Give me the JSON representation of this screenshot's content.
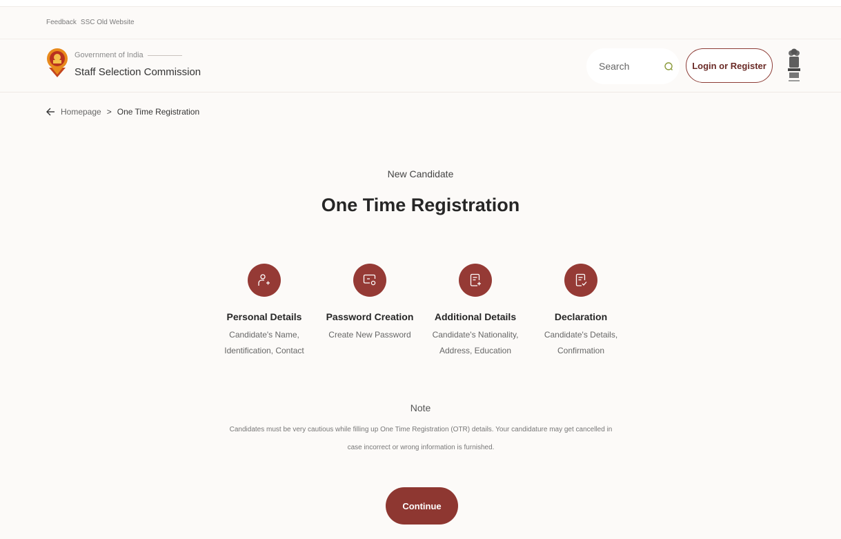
{
  "top_links": {
    "feedback": "Feedback",
    "old_website": "SSC Old Website"
  },
  "header": {
    "gov_label": "Government of India",
    "org_name": "Staff Selection Commission",
    "search": {
      "placeholder": "Search",
      "icon": "search-icon"
    },
    "login_label": "Login or Register"
  },
  "breadcrumb": {
    "home": "Homepage",
    "separator": ">",
    "current": "One Time Registration"
  },
  "main": {
    "subtitle": "New Candidate",
    "title": "One Time Registration",
    "steps": [
      {
        "label": "Personal Details",
        "desc_line1": "Candidate's Name,",
        "desc_line2": "Identification, Contact",
        "icon": "user-add-icon"
      },
      {
        "label": "Password Creation",
        "desc_line1": "Create New Password",
        "desc_line2": "",
        "icon": "password-icon"
      },
      {
        "label": "Additional Details",
        "desc_line1": "Candidate's Nationality,",
        "desc_line2": "Address, Education",
        "icon": "document-add-icon"
      },
      {
        "label": "Declaration",
        "desc_line1": "Candidate's Details,",
        "desc_line2": "Confirmation",
        "icon": "document-check-icon"
      }
    ],
    "note_title": "Note",
    "note_text": "Candidates must be very cautious while filling up One Time Registration (OTR) details. Your candidature may get cancelled in case incorrect or wrong information is furnished.",
    "continue_label": "Continue"
  },
  "colors": {
    "accent": "#953a35",
    "background": "#fcfaf8"
  }
}
